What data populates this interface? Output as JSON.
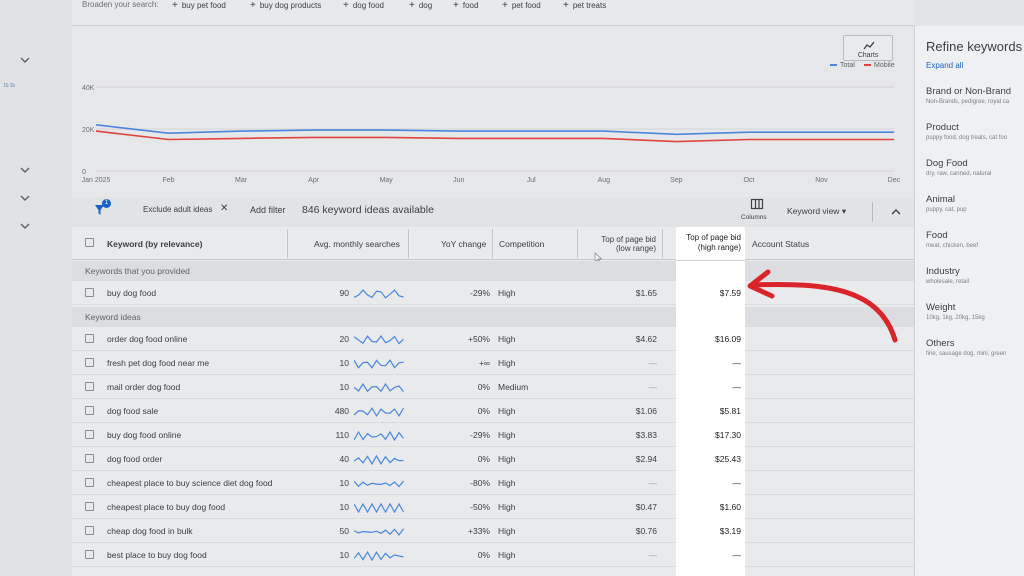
{
  "left_nav": {
    "partial_text": "ts ts"
  },
  "broaden": {
    "label": "Broaden your search:",
    "chips": [
      "buy pet food",
      "buy dog products",
      "dog food",
      "dog",
      "food",
      "pet food",
      "pet treats"
    ]
  },
  "chart_panel": {
    "charts_button": "Charts",
    "legend": [
      "Total",
      "Mobile"
    ]
  },
  "chart_data": {
    "type": "line",
    "x": [
      "Jan 2025",
      "Feb",
      "Mar",
      "Apr",
      "May",
      "Jun",
      "Jul",
      "Aug",
      "Sep",
      "Oct",
      "Nov",
      "Dec"
    ],
    "y_ticks": [
      "40K",
      "20K",
      "0"
    ],
    "ylim": [
      0,
      40000
    ],
    "series": [
      {
        "name": "Total",
        "color": "#4a86e0",
        "values": [
          22000,
          18000,
          19000,
          19500,
          19500,
          19000,
          19000,
          19000,
          17500,
          18500,
          18500,
          18500
        ]
      },
      {
        "name": "Mobile",
        "color": "#e0443c",
        "values": [
          19000,
          15000,
          15500,
          16000,
          16000,
          15500,
          15500,
          15500,
          14000,
          15000,
          15000,
          15000
        ]
      }
    ]
  },
  "toolbar": {
    "filter_badge": "1",
    "chip_label": "Exclude adult ideas",
    "add_filter": "Add filter",
    "count": "846 keyword ideas available",
    "columns": "Columns",
    "keyword_view": "Keyword view"
  },
  "table": {
    "headers": {
      "keyword": "Keyword (by relevance)",
      "avg": "Avg. monthly searches",
      "yoy": "YoY change",
      "competition": "Competition",
      "low_l1": "Top of page bid",
      "low_l2": "(low range)",
      "high_l1": "Top of page bid",
      "high_l2": "(high range)",
      "status": "Account Status"
    },
    "section_provided": "Keywords that you provided",
    "section_ideas": "Keyword ideas",
    "provided": [
      {
        "keyword": "buy dog food",
        "searches": "90",
        "yoy": "-29%",
        "competition": "High",
        "low": "$1.65",
        "high": "$7.59"
      }
    ],
    "ideas": [
      {
        "keyword": "order dog food online",
        "searches": "20",
        "yoy": "+50%",
        "competition": "High",
        "low": "$4.62",
        "high": "$16.09"
      },
      {
        "keyword": "fresh pet dog food near me",
        "searches": "10",
        "yoy": "+∞",
        "competition": "High",
        "low": "—",
        "high": "—"
      },
      {
        "keyword": "mail order dog food",
        "searches": "10",
        "yoy": "0%",
        "competition": "Medium",
        "low": "—",
        "high": "—"
      },
      {
        "keyword": "dog food sale",
        "searches": "480",
        "yoy": "0%",
        "competition": "High",
        "low": "$1.06",
        "high": "$5.81"
      },
      {
        "keyword": "buy dog food online",
        "searches": "110",
        "yoy": "-29%",
        "competition": "High",
        "low": "$3.83",
        "high": "$17.30"
      },
      {
        "keyword": "dog food order",
        "searches": "40",
        "yoy": "0%",
        "competition": "High",
        "low": "$2.94",
        "high": "$25.43"
      },
      {
        "keyword": "cheapest place to buy science diet dog food",
        "searches": "10",
        "yoy": "-80%",
        "competition": "High",
        "low": "—",
        "high": "—"
      },
      {
        "keyword": "cheapest place to buy dog food",
        "searches": "10",
        "yoy": "-50%",
        "competition": "High",
        "low": "$0.47",
        "high": "$1.60"
      },
      {
        "keyword": "cheap dog food in bulk",
        "searches": "50",
        "yoy": "+33%",
        "competition": "High",
        "low": "$0.76",
        "high": "$3.19"
      },
      {
        "keyword": "best place to buy dog food",
        "searches": "10",
        "yoy": "0%",
        "competition": "High",
        "low": "—",
        "high": "—"
      }
    ]
  },
  "refine": {
    "title": "Refine keywords",
    "expand_all": "Expand all",
    "facets": [
      {
        "title": "Brand or Non-Brand",
        "sub": "Non-Brands, pedigree, royal ca"
      },
      {
        "title": "Product",
        "sub": "puppy food, dog treats, cat foo"
      },
      {
        "title": "Dog Food",
        "sub": "dry, raw, canned, natural"
      },
      {
        "title": "Animal",
        "sub": "puppy, cat, pup"
      },
      {
        "title": "Food",
        "sub": "meat, chicken, beef"
      },
      {
        "title": "Industry",
        "sub": "wholesale, retail"
      },
      {
        "title": "Weight",
        "sub": "10kg, 1kg, 20kg, 15kg"
      },
      {
        "title": "Others",
        "sub": "fine, sausage dog, mini, green"
      }
    ]
  },
  "colors": {
    "accent": "#1a62c7",
    "annotation_arrow": "#d9252a"
  }
}
